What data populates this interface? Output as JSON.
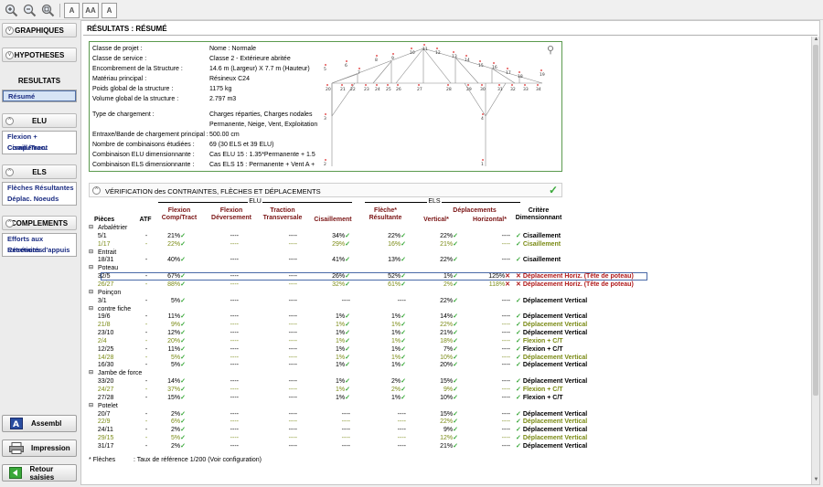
{
  "toolbar": {
    "icons": [
      "zoom-in-icon",
      "zoom-out-icon",
      "zoom-fit-icon",
      "font-size-icon",
      "font-grow-icon",
      "font-shrink-icon"
    ],
    "font_size_label": "A",
    "font_grow_label": "AA",
    "font_shrink_label": "A"
  },
  "sidebar": {
    "graphiques": "GRAPHIQUES",
    "hypotheses": "HYPOTHESES",
    "resultats": "RESULTATS",
    "resume": "Résumé",
    "elu": "ELU",
    "elu_items": [
      "Flexion + Comp./Trac.",
      "Cisaillement"
    ],
    "els": "ELS",
    "els_items": [
      "Flèches Résultantes",
      "Déplac. Noeuds"
    ],
    "complements": "COMPLEMENTS",
    "complements_items": [
      "Efforts aux Extrémités",
      "Réactions d'appuis"
    ],
    "assembl": "Assembl",
    "impression": "Impression",
    "retour": "Retour saisies"
  },
  "main": {
    "title": "RÉSULTATS : RÉSUMÉ",
    "summary": [
      {
        "label": "Classe de projet :",
        "value": "Nome : Normale"
      },
      {
        "label": "Classe de service :",
        "value": "Classe 2 - Extérieure abritée"
      },
      {
        "label": "Encombrement de la Structure :",
        "value": "14.6 m (Largeur) X 7.7 m (Hauteur)"
      },
      {
        "label": "Matériau principal :",
        "value": "Résineux C24"
      },
      {
        "label": "Poids global de la structure :",
        "value": "1175 kg"
      },
      {
        "label": "Volume global de la structure :",
        "value": "2.797 m3"
      },
      {
        "label": "Type de chargement :",
        "value": "Charges réparties, Charges nodales"
      },
      {
        "label": "",
        "value": "Permanente, Neige, Vent, Exploitation"
      },
      {
        "label": "Entraxe/Bande de chargement principal :",
        "value": "500.00 cm"
      },
      {
        "label": "Nombre de combinaisons étudiées :",
        "value": "69 (30 ELS et 39 ELU)"
      },
      {
        "label": "Combinaison ELU dimensionnante :",
        "value": "Cas ELU 15 :  1.35*Permanente + 1.5"
      },
      {
        "label": "Combinaison ELS dimensionnante :",
        "value": "Cas ELS 15 :  Permanente + Vent A +"
      }
    ],
    "nodes": [
      "5",
      "6",
      "7",
      "8",
      "9",
      "10",
      "11",
      "12",
      "13",
      "14",
      "15",
      "16",
      "17",
      "18",
      "19",
      "20",
      "21",
      "22",
      "23",
      "24",
      "25",
      "26",
      "27",
      "28",
      "29",
      "30",
      "31",
      "32",
      "33",
      "34",
      "3",
      "2",
      "4",
      "1"
    ],
    "verification_title": "VÉRIFICATION des CONTRAINTES, FLÈCHES ET DÉPLACEMENTS",
    "group_elu": "ELU",
    "group_els": "ELS",
    "deplacements": "Déplacements",
    "columns": {
      "pieces": "Pièces",
      "atf": "ATF",
      "flexion_ct": "Flexion\nComp/Tract",
      "flexion_dev": "Flexion\nDéversement",
      "traction": "Traction\nTransversale",
      "cisaillement": "Cisaillement",
      "fleche": "Flèche*\nRésultante",
      "vertical": "Vertical*",
      "horizontal": "Horizontal*",
      "critere": "Critère\nDimensionnant"
    },
    "rows": [
      {
        "group": "Arbalétrier"
      },
      {
        "name": "5/1",
        "atf": "-",
        "ft": "21%",
        "dv": "----",
        "tr": "----",
        "ci": "34%",
        "fl": "22%",
        "ve": "22%",
        "ho": "----",
        "cr": "Cisaillement",
        "c": "b"
      },
      {
        "name": "1/17",
        "atf": "-",
        "ft": "22%",
        "dv": "----",
        "tr": "----",
        "ci": "29%",
        "fl": "16%",
        "ve": "21%",
        "ho": "----",
        "cr": "Cisaillement",
        "c": "o"
      },
      {
        "group": "Entrait"
      },
      {
        "name": "18/31",
        "atf": "-",
        "ft": "40%",
        "dv": "----",
        "tr": "----",
        "ci": "41%",
        "fl": "13%",
        "ve": "22%",
        "ho": "----",
        "cr": "Cisaillement",
        "c": "b"
      },
      {
        "group": "Poteau"
      },
      {
        "name": "32/5",
        "atf": "-",
        "ft": "67%",
        "dv": "----",
        "tr": "----",
        "ci": "26%",
        "fl": "52%",
        "ve": "1%",
        "ho": "125%",
        "cr": "Déplacement Horiz. (Tête de poteau)",
        "c": "r",
        "hi": true
      },
      {
        "name": "26/27",
        "atf": "-",
        "ft": "88%",
        "dv": "----",
        "tr": "----",
        "ci": "32%",
        "fl": "61%",
        "ve": "2%",
        "ho": "118%",
        "cr": "Déplacement Horiz. (Tête de poteau)",
        "c": "ro"
      },
      {
        "group": "Poinçon"
      },
      {
        "name": "3/1",
        "atf": "-",
        "ft": "5%",
        "dv": "----",
        "tr": "----",
        "ci": "----",
        "fl": "----",
        "ve": "22%",
        "ho": "----",
        "cr": "Déplacement Vertical",
        "c": "b"
      },
      {
        "group": "contre fiche"
      },
      {
        "name": "19/6",
        "atf": "-",
        "ft": "11%",
        "dv": "----",
        "tr": "----",
        "ci": "1%",
        "fl": "1%",
        "ve": "14%",
        "ho": "----",
        "cr": "Déplacement Vertical",
        "c": "b"
      },
      {
        "name": "21/8",
        "atf": "-",
        "ft": "9%",
        "dv": "----",
        "tr": "----",
        "ci": "1%",
        "fl": "1%",
        "ve": "22%",
        "ho": "----",
        "cr": "Déplacement Vertical",
        "c": "o"
      },
      {
        "name": "23/10",
        "atf": "-",
        "ft": "12%",
        "dv": "----",
        "tr": "----",
        "ci": "1%",
        "fl": "1%",
        "ve": "21%",
        "ho": "----",
        "cr": "Déplacement Vertical",
        "c": "b"
      },
      {
        "name": "2/4",
        "atf": "-",
        "ft": "20%",
        "dv": "----",
        "tr": "----",
        "ci": "1%",
        "fl": "1%",
        "ve": "18%",
        "ho": "----",
        "cr": "Flexion + C/T",
        "c": "o"
      },
      {
        "name": "12/25",
        "atf": "-",
        "ft": "11%",
        "dv": "----",
        "tr": "----",
        "ci": "1%",
        "fl": "1%",
        "ve": "7%",
        "ho": "----",
        "cr": "Flexion + C/T",
        "c": "b"
      },
      {
        "name": "14/28",
        "atf": "-",
        "ft": "5%",
        "dv": "----",
        "tr": "----",
        "ci": "1%",
        "fl": "1%",
        "ve": "10%",
        "ho": "----",
        "cr": "Déplacement Vertical",
        "c": "o"
      },
      {
        "name": "16/30",
        "atf": "-",
        "ft": "5%",
        "dv": "----",
        "tr": "----",
        "ci": "1%",
        "fl": "1%",
        "ve": "20%",
        "ho": "----",
        "cr": "Déplacement Vertical",
        "c": "b"
      },
      {
        "group": "Jambe de force"
      },
      {
        "name": "33/20",
        "atf": "-",
        "ft": "14%",
        "dv": "----",
        "tr": "----",
        "ci": "1%",
        "fl": "2%",
        "ve": "15%",
        "ho": "----",
        "cr": "Déplacement Vertical",
        "c": "b"
      },
      {
        "name": "24/27",
        "atf": "-",
        "ft": "37%",
        "dv": "----",
        "tr": "----",
        "ci": "1%",
        "fl": "2%",
        "ve": "9%",
        "ho": "----",
        "cr": "Flexion + C/T",
        "c": "o"
      },
      {
        "name": "27/28",
        "atf": "-",
        "ft": "15%",
        "dv": "----",
        "tr": "----",
        "ci": "1%",
        "fl": "1%",
        "ve": "10%",
        "ho": "----",
        "cr": "Flexion + C/T",
        "c": "b"
      },
      {
        "group": "Potelet"
      },
      {
        "name": "20/7",
        "atf": "-",
        "ft": "2%",
        "dv": "----",
        "tr": "----",
        "ci": "----",
        "fl": "----",
        "ve": "15%",
        "ho": "----",
        "cr": "Déplacement Vertical",
        "c": "b"
      },
      {
        "name": "22/9",
        "atf": "-",
        "ft": "6%",
        "dv": "----",
        "tr": "----",
        "ci": "----",
        "fl": "----",
        "ve": "22%",
        "ho": "----",
        "cr": "Déplacement Vertical",
        "c": "o"
      },
      {
        "name": "24/11",
        "atf": "-",
        "ft": "2%",
        "dv": "----",
        "tr": "----",
        "ci": "----",
        "fl": "----",
        "ve": "9%",
        "ho": "----",
        "cr": "Déplacement Vertical",
        "c": "b"
      },
      {
        "name": "29/15",
        "atf": "-",
        "ft": "5%",
        "dv": "----",
        "tr": "----",
        "ci": "----",
        "fl": "----",
        "ve": "12%",
        "ho": "----",
        "cr": "Déplacement Vertical",
        "c": "o"
      },
      {
        "name": "31/17",
        "atf": "-",
        "ft": "2%",
        "dv": "----",
        "tr": "----",
        "ci": "----",
        "fl": "----",
        "ve": "21%",
        "ho": "----",
        "cr": "Déplacement Vertical",
        "c": "b"
      }
    ],
    "footnote_label": "* Flèches",
    "footnote_text": ": Taux de référence 1/200 (Voir configuration)"
  },
  "colors": {
    "accent_green": "#3aa83a",
    "error_red": "#b01818",
    "olive": "#7a8a14",
    "header_red": "#7a1414"
  }
}
